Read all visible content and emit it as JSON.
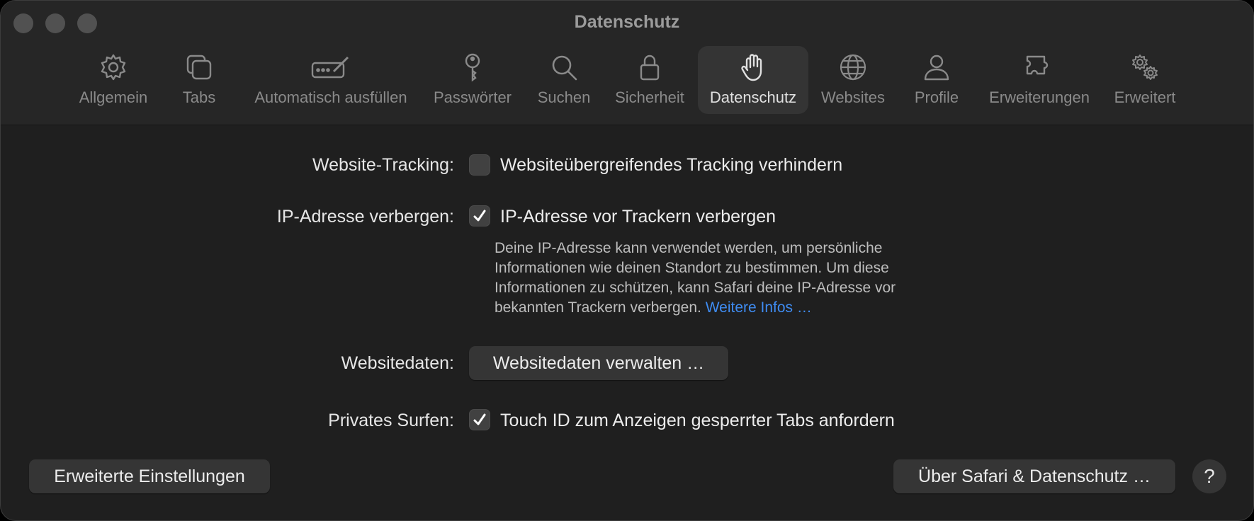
{
  "window": {
    "title": "Datenschutz"
  },
  "toolbar": {
    "items": [
      {
        "label": "Allgemein",
        "icon": "gear-icon"
      },
      {
        "label": "Tabs",
        "icon": "tabs-icon"
      },
      {
        "label": "Automatisch ausfüllen",
        "icon": "autofill-icon"
      },
      {
        "label": "Passwörter",
        "icon": "key-icon"
      },
      {
        "label": "Suchen",
        "icon": "magnifier-icon"
      },
      {
        "label": "Sicherheit",
        "icon": "lock-icon"
      },
      {
        "label": "Datenschutz",
        "icon": "hand-icon",
        "selected": true
      },
      {
        "label": "Websites",
        "icon": "globe-icon"
      },
      {
        "label": "Profile",
        "icon": "person-icon"
      },
      {
        "label": "Erweiterungen",
        "icon": "puzzle-icon"
      },
      {
        "label": "Erweitert",
        "icon": "gears-icon"
      }
    ]
  },
  "settings": {
    "tracking": {
      "label": "Website-Tracking:",
      "option": "Websiteübergreifendes Tracking verhindern",
      "checked": false
    },
    "ip": {
      "label": "IP-Adresse verbergen:",
      "option": "IP-Adresse vor Trackern verbergen",
      "checked": true,
      "description_lines": [
        "Deine IP-Adresse kann verwendet werden, um persönliche",
        "Informationen wie deinen Standort zu bestimmen. Um diese",
        "Informationen zu schützen, kann Safari deine IP-Adresse vor",
        "bekannten Trackern verbergen."
      ],
      "link": "Weitere Infos …"
    },
    "websitedata": {
      "label": "Websitedaten:",
      "button": "Websitedaten verwalten …"
    },
    "private": {
      "label": "Privates Surfen:",
      "option": "Touch ID zum Anzeigen gesperrter Tabs anfordern",
      "checked": true
    }
  },
  "footer": {
    "advanced_button": "Erweiterte Einstellungen",
    "about_button": "Über Safari & Datenschutz …",
    "help_button": "?"
  },
  "colors": {
    "background": "#1f1f1f",
    "link": "#3f8cf2",
    "accent_selected_tab": "#343434"
  }
}
